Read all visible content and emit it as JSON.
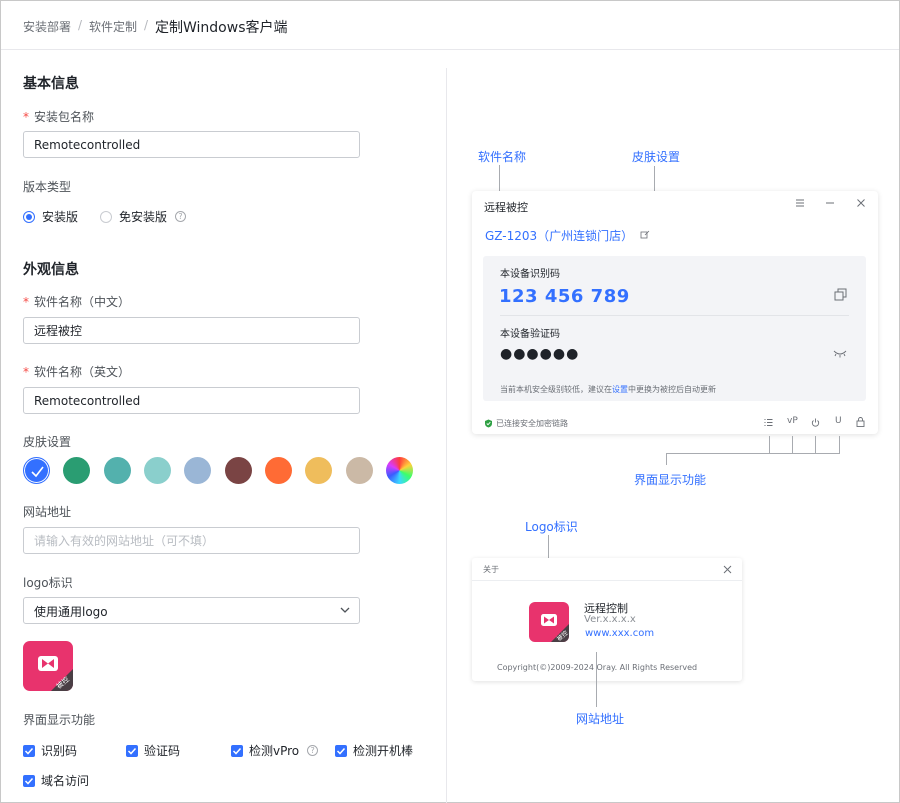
{
  "breadcrumb": {
    "items": [
      "安装部署",
      "软件定制",
      "定制Windows客户端"
    ],
    "separator": "/"
  },
  "basic": {
    "title": "基本信息",
    "package_name_label": "安装包名称",
    "package_name_value": "Remotecontrolled",
    "version_type_label": "版本类型",
    "version_options": [
      "安装版",
      "免安装版"
    ],
    "version_selected": "安装版"
  },
  "appearance": {
    "title": "外观信息",
    "name_cn_label": "软件名称（中文）",
    "name_cn_value": "远程被控",
    "name_en_label": "软件名称（英文）",
    "name_en_value": "Remotecontrolled",
    "skin_label": "皮肤设置",
    "skins": [
      "#3370ff",
      "#2a9d72",
      "#53b1ad",
      "#8acfcc",
      "#9ab6d6",
      "#7a4444",
      "#ff6b35",
      "#efbd5c",
      "#cbb9a6",
      "rainbow"
    ],
    "website_label": "网站地址",
    "website_placeholder": "请输入有效的网站地址（可不填）",
    "logo_label": "logo标识",
    "logo_select_value": "使用通用logo",
    "logo_badge": "被控",
    "features_label": "界面显示功能",
    "features": [
      "识别码",
      "验证码",
      "检测vPro",
      "检测开机棒",
      "域名访问"
    ]
  },
  "preview": {
    "ann_software_name": "软件名称",
    "ann_skin": "皮肤设置",
    "ann_ui_features": "界面显示功能",
    "ann_logo": "Logo标识",
    "ann_website": "网站地址",
    "window_title": "远程被控",
    "device_name": "GZ-1203（广州连锁门店）",
    "id_label": "本设备识别码",
    "id_code": "123 456 789",
    "verify_label": "本设备验证码",
    "verify_code": "●●●●●●",
    "note_prefix": "当前本机安全级别较低，建议在",
    "note_link": "设置",
    "note_suffix": "中更换为被控后自动更新",
    "footer_status": "已连接安全加密链路",
    "footer_icons": [
      "list-icon",
      "vP",
      "power-icon",
      "U",
      "lock-icon"
    ],
    "footer_vp": "vP",
    "footer_u": "U"
  },
  "about": {
    "header": "关于",
    "app_name": "远程控制",
    "version": "Ver.x.x.x.x",
    "website": "www.xxx.com",
    "copyright": "Copyright(©)2009-2024 Oray. All Rights Reserved",
    "logo_badge": "被控"
  }
}
